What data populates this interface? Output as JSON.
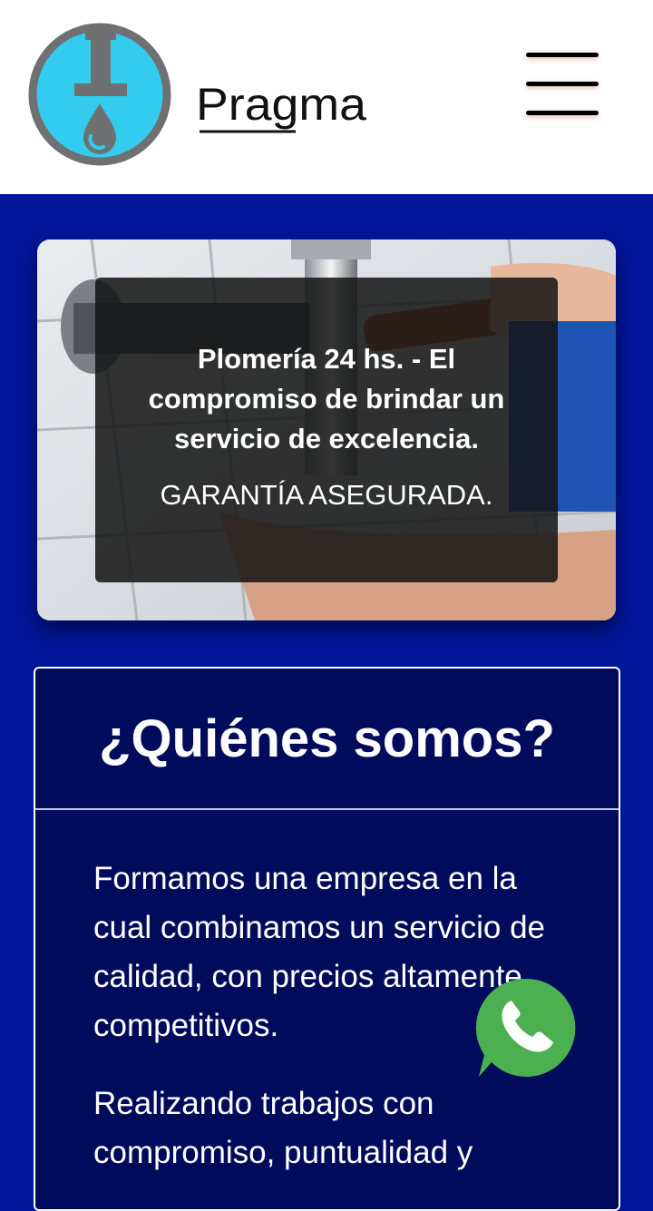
{
  "header": {
    "brand_name": "Pragma",
    "menu_label": "menu"
  },
  "hero": {
    "title": "Plomería 24 hs. - El compromiso de brindar un servicio de excelencia.",
    "subtitle": "GARANTÍA ASEGURADA."
  },
  "about": {
    "title": "¿Quiénes somos?",
    "paragraph_1": "Formamos una empresa en la cual combinamos un servicio de calidad, con precios altamente competitivos.",
    "paragraph_2": "Realizando trabajos con compromiso, puntualidad y"
  },
  "whatsapp": {
    "icon": "whatsapp-phone-icon",
    "color": "#4caf50"
  },
  "colors": {
    "page_background": "#001699",
    "card_background": "#000b5c",
    "logo_accent": "#33ccef",
    "logo_gray": "#6f7072"
  }
}
